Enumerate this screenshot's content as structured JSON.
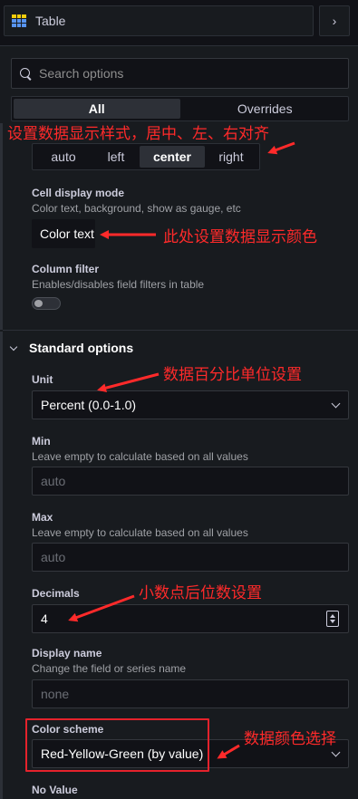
{
  "header": {
    "viz_title": "Table",
    "viz_icon": "table-icon",
    "collapse_icon": "chevron-right-icon"
  },
  "search": {
    "placeholder": "Search options"
  },
  "tabs": [
    {
      "label": "All",
      "active": true
    },
    {
      "label": "Overrides",
      "active": false
    }
  ],
  "alignment": {
    "options": [
      "auto",
      "left",
      "center",
      "right"
    ],
    "selected": "center"
  },
  "cell_display_mode": {
    "label": "Cell display mode",
    "description": "Color text, background, show as gauge, etc",
    "value": "Color text"
  },
  "column_filter": {
    "label": "Column filter",
    "description": "Enables/disables field filters in table",
    "enabled": false
  },
  "standard_options": {
    "title": "Standard options",
    "unit": {
      "label": "Unit",
      "value": "Percent (0.0-1.0)"
    },
    "min": {
      "label": "Min",
      "description": "Leave empty to calculate based on all values",
      "placeholder": "auto"
    },
    "max": {
      "label": "Max",
      "description": "Leave empty to calculate based on all values",
      "placeholder": "auto"
    },
    "decimals": {
      "label": "Decimals",
      "value": "4"
    },
    "display_name": {
      "label": "Display name",
      "description": "Change the field or series name",
      "placeholder": "none"
    },
    "color_scheme": {
      "label": "Color scheme",
      "value": "Red-Yellow-Green (by value)"
    },
    "no_value": {
      "label": "No Value"
    }
  },
  "annotations": {
    "alignment": "设置数据显示样式，居中、左、右对齐",
    "display_color": "此处设置数据显示颜色",
    "unit": "数据百分比单位设置",
    "decimals": "小数点后位数设置",
    "color_scheme": "数据颜色选择"
  },
  "colors": {
    "background": "#111217",
    "panel": "#181b1f",
    "annotation": "#ff2a2a",
    "highlight_border": "#e5222c"
  }
}
